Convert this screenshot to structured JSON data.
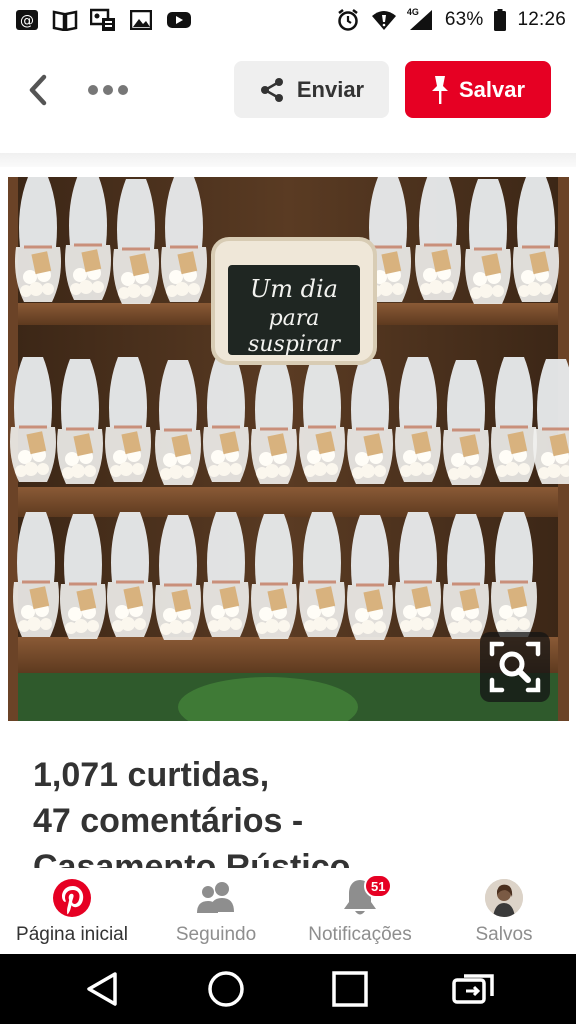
{
  "status_bar": {
    "left_icons": [
      "at-sign-icon",
      "book-icon",
      "profile-card-icon",
      "image-icon",
      "youtube-icon"
    ],
    "network_label": "4G",
    "battery": "63%",
    "time": "12:26"
  },
  "action_bar": {
    "send_label": "Enviar",
    "save_label": "Salvar"
  },
  "pin": {
    "sign_text_lines": [
      "Um dia",
      "para",
      "suspirar"
    ],
    "title_lines": [
      "1,071 curtidas,",
      "47 comentários -",
      "Casamento Rústico"
    ]
  },
  "bottom_nav": {
    "items": [
      {
        "label": "Página inicial",
        "icon": "pinterest-logo-icon",
        "active": true
      },
      {
        "label": "Seguindo",
        "icon": "people-icon",
        "active": false
      },
      {
        "label": "Notificações",
        "icon": "bell-icon",
        "badge": "51",
        "active": false
      },
      {
        "label": "Salvos",
        "icon": "avatar",
        "active": false
      }
    ]
  },
  "colors": {
    "brand_red": "#e60023",
    "button_gray": "#efefef"
  }
}
